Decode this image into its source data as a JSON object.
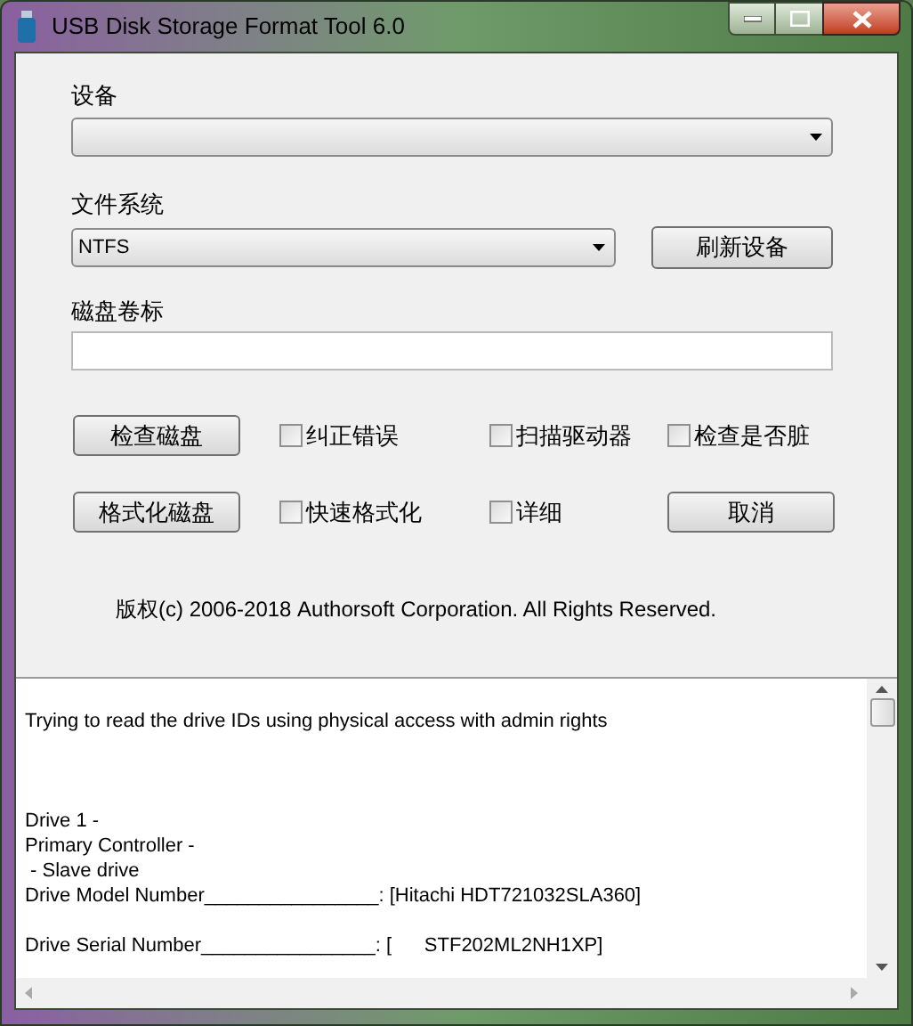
{
  "window": {
    "title": "USB Disk Storage Format Tool 6.0"
  },
  "device": {
    "label": "设备"
  },
  "file_system": {
    "label": "文件系统",
    "value": "NTFS"
  },
  "refresh_button": "刷新设备",
  "volume_label": {
    "label": "磁盘卷标"
  },
  "rows": [
    {
      "button": "检查磁盘",
      "items": [
        {
          "kind": "checkbox",
          "label": "纠正错误",
          "checked": false
        },
        {
          "kind": "checkbox",
          "label": "扫描驱动器",
          "checked": false
        },
        {
          "kind": "checkbox",
          "label": "检查是否脏",
          "checked": false
        }
      ]
    },
    {
      "button": "格式化磁盘",
      "items": [
        {
          "kind": "checkbox",
          "label": "快速格式化",
          "checked": false
        },
        {
          "kind": "checkbox",
          "label": "详细",
          "checked": false
        },
        {
          "kind": "button",
          "label": "取消"
        }
      ]
    }
  ],
  "copyright": "版权(c) 2006-2018 Authorsoft Corporation. All Rights Reserved.",
  "log": [
    [
      "Trying to read the drive IDs using physical access with admin rights"
    ],
    [
      "Drive 1 -",
      "Primary Controller -",
      " - Slave drive",
      "Drive Model Number________________: [Hitachi HDT721032SLA360]"
    ],
    [
      "Drive Serial Number________________: [      STF202ML2NH1XP]"
    ]
  ]
}
